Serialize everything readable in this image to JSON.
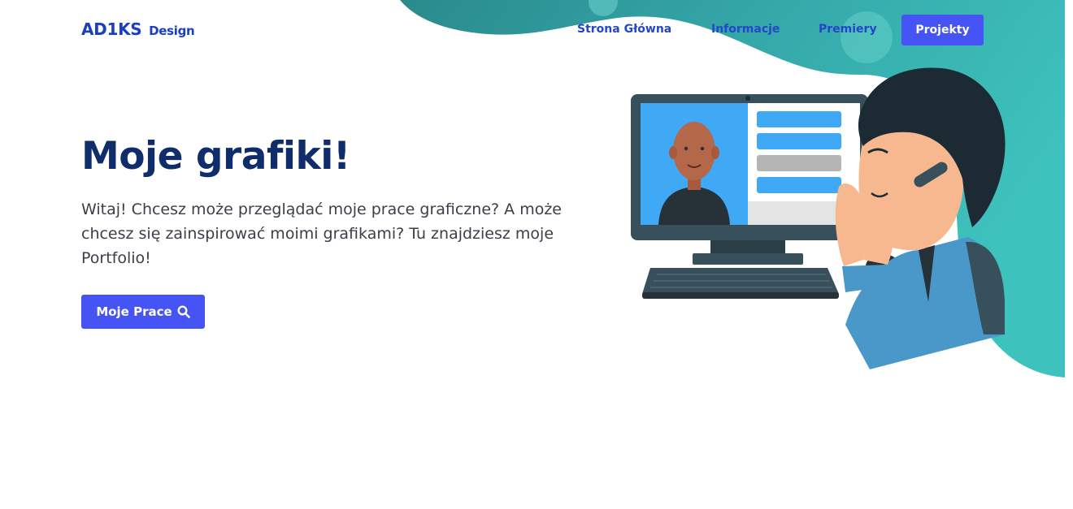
{
  "brand": {
    "name": "AD1KS",
    "sub": "Design"
  },
  "nav": {
    "links": [
      "Strona Główna",
      "Informacje",
      "Premiery"
    ],
    "cta": "Projekty"
  },
  "hero": {
    "title": "Moje grafiki!",
    "text": "Witaj! Chcesz może przeglądać moje prace graficzne? A może chcesz się zainspirować moimi grafikami? Tu znajdziesz moje Portfolio!",
    "button_label": "Moje Prace",
    "button_icon": "search-icon"
  },
  "illustration": {
    "subject": "man-on-video-call-illustration"
  },
  "colors": {
    "primary": "#4654f5",
    "brand": "#1a3fbf",
    "title": "#0f2d6b",
    "teal": "#2fb3b1"
  }
}
